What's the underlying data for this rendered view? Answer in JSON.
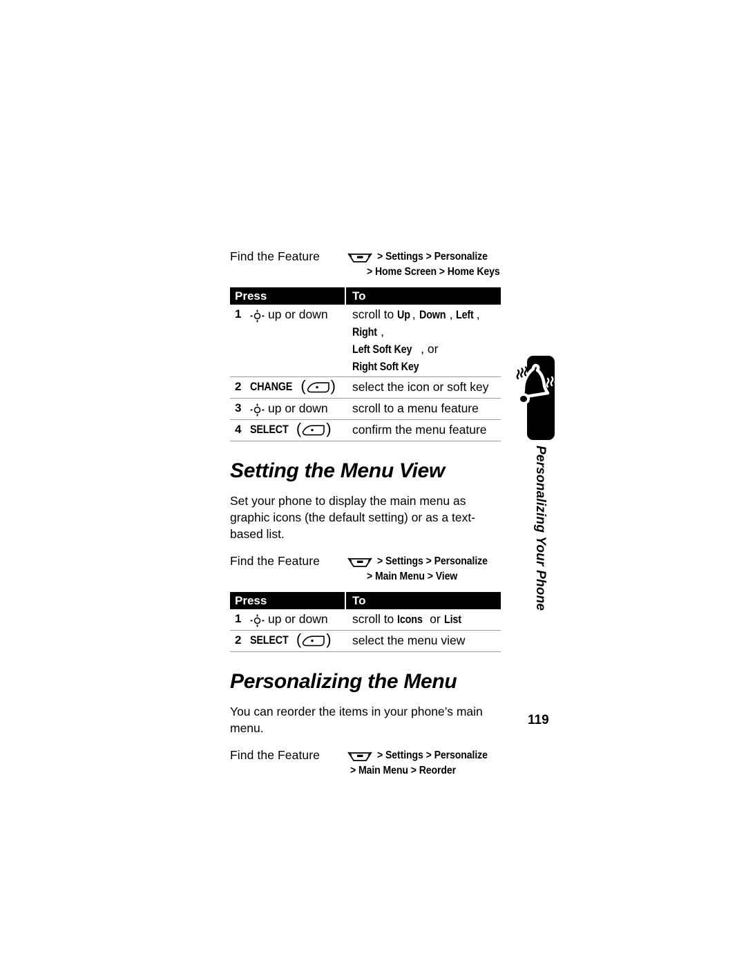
{
  "page": {
    "number": "119",
    "tab_label": "Personalizing Your Phone",
    "tab_icon": "ringing-bell-icon"
  },
  "icons": {
    "menu_key": "menu-key-icon",
    "nav_key": "navigation-key-icon",
    "soft_key": "soft-key-icon"
  },
  "blocks": {
    "find_feature_1": {
      "label": "Find the Feature",
      "line1": "> Settings > Personalize",
      "line2": "> Home Screen > Home Keys"
    },
    "find_feature_2": {
      "label": "Find the Feature",
      "line1": "> Settings > Personalize",
      "line2": "> Main Menu > View"
    },
    "find_feature_3": {
      "label": "Find the Feature",
      "line1": "> Settings > Personalize",
      "line2": "> Main Menu > Reorder"
    }
  },
  "table1": {
    "header": {
      "press": "Press",
      "to": "To"
    },
    "rows": [
      {
        "num": "1",
        "press_text": "up or down",
        "to_prefix": "scroll to ",
        "to_terms_line1": [
          "Up",
          "Down",
          "Left",
          "Right"
        ],
        "to_terms_line2_a": "Left Soft Key",
        "to_terms_line2_mid": ", or ",
        "to_terms_line2_b": "Right Soft Key"
      },
      {
        "num": "2",
        "key_label": "CHANGE",
        "to": "select the icon or soft key"
      },
      {
        "num": "3",
        "press_text": "up or down",
        "to": "scroll to a menu feature"
      },
      {
        "num": "4",
        "key_label": "SELECT",
        "to": "confirm the menu feature"
      }
    ]
  },
  "section1": {
    "heading": "Setting the Menu View",
    "body": "Set your phone to display the main menu as graphic icons (the default setting) or as a text-based list."
  },
  "table2": {
    "header": {
      "press": "Press",
      "to": "To"
    },
    "rows": [
      {
        "num": "1",
        "press_text": "up or down",
        "to_prefix": "scroll to ",
        "term_a": "Icons",
        "mid": " or ",
        "term_b": "List"
      },
      {
        "num": "2",
        "key_label": "SELECT",
        "to": "select the menu view"
      }
    ]
  },
  "section2": {
    "heading": "Personalizing the Menu",
    "body": "You can reorder the items in your phone’s main menu."
  },
  "colors": {
    "page_background": "#ffffff",
    "text": "#000000",
    "table_header_background": "#000000",
    "table_header_text": "#ffffff",
    "rule": "#9a9a9a",
    "tab_background": "#000000"
  }
}
